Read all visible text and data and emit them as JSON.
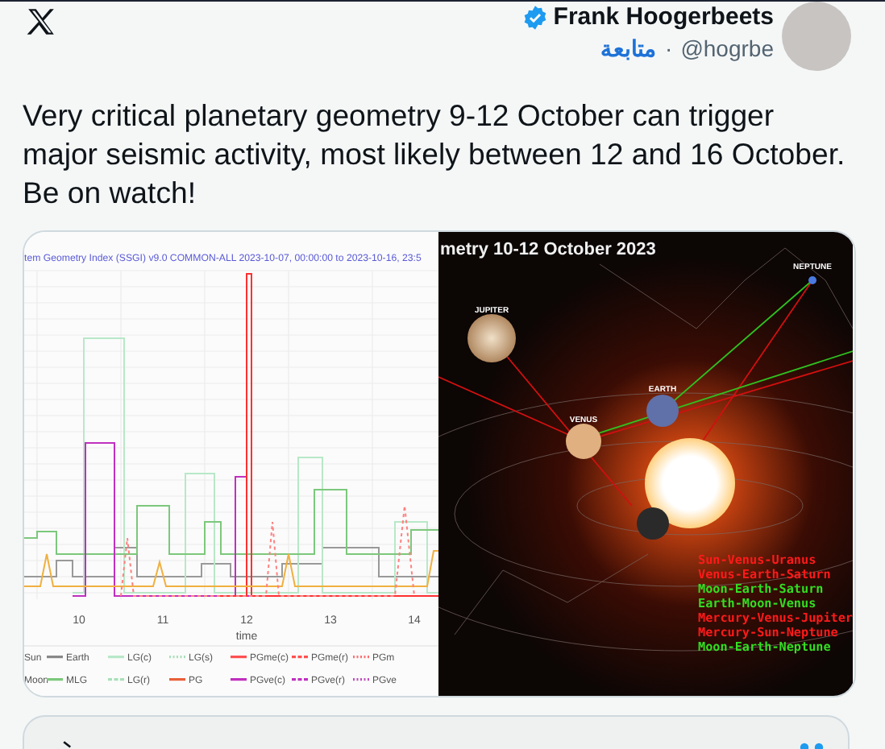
{
  "header": {
    "author_name": "Frank Hoogerbeets",
    "verified": true,
    "follow_label": "متابعة",
    "separator": "·",
    "handle": "@hogrbe"
  },
  "tweet_text": "Very critical planetary geometry 9-12 October can trigger major seismic activity, most likely between 12 and 16 October. Be on watch!",
  "media": {
    "chart": {
      "title": "tem Geometry Index (SSGI) v9.0 COMMON-ALL 2023-10-07, 00:00:00 to 2023-10-16, 23:5",
      "x_tick_labels": [
        "10",
        "11",
        "12",
        "13",
        "14"
      ],
      "x_label": "time",
      "legend": [
        {
          "label": "Sun",
          "kind": "text"
        },
        {
          "label": "Earth",
          "kind": "solid",
          "color": "#888888"
        },
        {
          "label": "LG(c)",
          "kind": "solid",
          "color": "#b8e8c8"
        },
        {
          "label": "LG(s)",
          "kind": "dotted",
          "color": "#a8e0b8"
        },
        {
          "label": "PGme(c)",
          "kind": "solid",
          "color": "#ff5050"
        },
        {
          "label": "PGme(r)",
          "kind": "dashed",
          "color": "#ff5050"
        },
        {
          "label": "PGm",
          "kind": "dotted",
          "color": "#ff7070"
        },
        {
          "label": "Moon",
          "kind": "text"
        },
        {
          "label": "MLG",
          "kind": "solid",
          "color": "#7cc87c"
        },
        {
          "label": "LG(r)",
          "kind": "dashed",
          "color": "#a8e0b8"
        },
        {
          "label": "PG",
          "kind": "solid",
          "color": "#e8603a"
        },
        {
          "label": "PGve(c)",
          "kind": "solid",
          "color": "#c030c0"
        },
        {
          "label": "PGve(r)",
          "kind": "dashed",
          "color": "#c030c0"
        },
        {
          "label": "PGve",
          "kind": "dotted",
          "color": "#c050c0"
        }
      ]
    },
    "sky_map": {
      "title": "metry 10-12 October 2023",
      "planet_labels": [
        "JUPITER",
        "NEPTUNE",
        "EARTH",
        "VENUS"
      ],
      "alignments": [
        {
          "text": "Sun-Venus-Uranus",
          "color": "#ff1a1a"
        },
        {
          "text": "Venus-Earth-Saturn",
          "color": "#ff1a1a"
        },
        {
          "text": "Moon-Earth-Saturn",
          "color": "#33dd22"
        },
        {
          "text": "Earth-Moon-Venus",
          "color": "#33dd22"
        },
        {
          "text": "Mercury-Venus-Jupiter",
          "color": "#ff1a1a"
        },
        {
          "text": "Mercury-Sun-Neptune",
          "color": "#ff1a1a"
        },
        {
          "text": "Moon-Earth-Neptune",
          "color": "#33dd22"
        }
      ]
    }
  }
}
